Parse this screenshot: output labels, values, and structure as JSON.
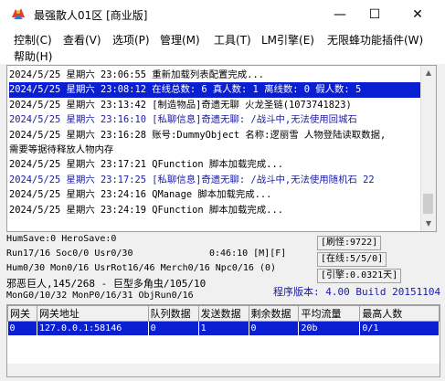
{
  "window": {
    "title": "最强散人01区 [商业版]",
    "minimize_label": "—",
    "maximize_label": "☐",
    "close_label": "✕",
    "icon": "colorful-bird-app-icon"
  },
  "menubar": {
    "items": [
      {
        "label": "控制(C)"
      },
      {
        "label": "查看(V)"
      },
      {
        "label": "选项(P)"
      },
      {
        "label": "管理(M)"
      },
      {
        "label": "工具(T)"
      },
      {
        "label": "LM引擎(E)"
      },
      {
        "label": "无限蜂功能插件(W)"
      },
      {
        "label": "帮助(H)"
      }
    ]
  },
  "log": {
    "lines": [
      {
        "text": "2024/5/25 星期六 23:06:55 重新加载列表配置完成...",
        "color": "#000000",
        "selected": false
      },
      {
        "text": "2024/5/25 星期六 23:08:12 在线总数: 6 真人数: 1 离线数: 0 假人数: 5",
        "color": "#ffffff",
        "selected": true
      },
      {
        "text": "2024/5/25 星期六 23:13:42 [制造物品]奇遗无聊 火龙圣链(1073741823)",
        "color": "#000000",
        "selected": false
      },
      {
        "text": "2024/5/25 星期六 23:16:10 [私聊信息]奇遗无聊: /战斗中,无法使用回城石",
        "color": "#1a1aa8",
        "selected": false
      },
      {
        "text": "2024/5/25 星期六 23:16:28 账号:DummyObject 名称:逻丽雪 人物登陆读取数据,",
        "color": "#000000",
        "selected": false
      },
      {
        "text": "需要等据待释放人物内存",
        "color": "#000000",
        "selected": false
      },
      {
        "text": "2024/5/25 星期六 23:17:21 QFunction 脚本加载完成...",
        "color": "#000000",
        "selected": false
      },
      {
        "text": "2024/5/25 星期六 23:17:25 [私聊信息]奇遗无聊: /战斗中,无法使用随机石 22",
        "color": "#1a1aa8",
        "selected": false
      },
      {
        "text": "2024/5/25 星期六 23:24:16 QManage 脚本加载完成...",
        "color": "#000000",
        "selected": false
      },
      {
        "text": "2024/5/25 星期六 23:24:19 QFunction 脚本加载完成...",
        "color": "#000000",
        "selected": false
      }
    ]
  },
  "status": {
    "humsave": "HumSave:0 HeroSave:0",
    "run": "Run17/16 Soc0/0 Usr0/30",
    "time": "0:46:10 [M][F]",
    "hum": "Hum0/30 Mon0/16 UsrRot16/46 Merch0/16 Npc0/16 (0)",
    "boss": "邪恶巨人,145/268 - 巨型多角虫/105/10",
    "mon": "MonG0/10/32 MonP0/16/31 ObjRun0/16",
    "refresh": "[刷怪:9722]",
    "online": "[在线:5/5/0]",
    "engine": "[引擎:0.0321天]",
    "version": "程序版本: 4.00 Build 20151104"
  },
  "grid": {
    "columns": [
      "网关",
      "网关地址",
      "队列数据",
      "发送数据",
      "剩余数据",
      "平均流量",
      "最高人数"
    ],
    "rows": [
      [
        "0",
        "127.0.0.1:58146",
        "0",
        "1",
        "0",
        "20b",
        "0/1"
      ]
    ]
  }
}
